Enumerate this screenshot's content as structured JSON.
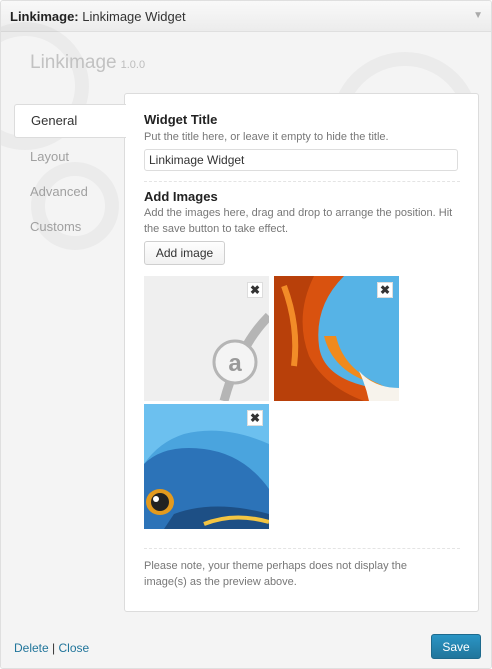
{
  "widget": {
    "title_bold": "Linkimage:",
    "title_rest": "Linkimage Widget",
    "arrow": "▼"
  },
  "plugin": {
    "name": "Linkimage",
    "version": "1.0.0"
  },
  "tabs": [
    {
      "label": "General",
      "active": true
    },
    {
      "label": "Layout"
    },
    {
      "label": "Advanced"
    },
    {
      "label": "Customs"
    }
  ],
  "general": {
    "title_label": "Widget Title",
    "title_desc": "Put the title here, or leave it empty to hide the title.",
    "title_value": "Linkimage Widget",
    "images_label": "Add Images",
    "images_desc": "Add the images here, drag and drop to arrange the position. Hit the save button to take effect.",
    "add_image": "Add image",
    "note": "Please note, your theme perhaps does not display the image(s) as the preview above.",
    "images": [
      {
        "icon": "amazon-logo",
        "remove": "✖"
      },
      {
        "icon": "firefox-logo",
        "remove": "✖"
      },
      {
        "icon": "thunderbird-logo",
        "remove": "✖"
      }
    ]
  },
  "footer": {
    "delete": "Delete",
    "sep": "|",
    "close": "Close",
    "save": "Save"
  },
  "colors": {
    "link": "#21759b",
    "save": "#21759b"
  }
}
